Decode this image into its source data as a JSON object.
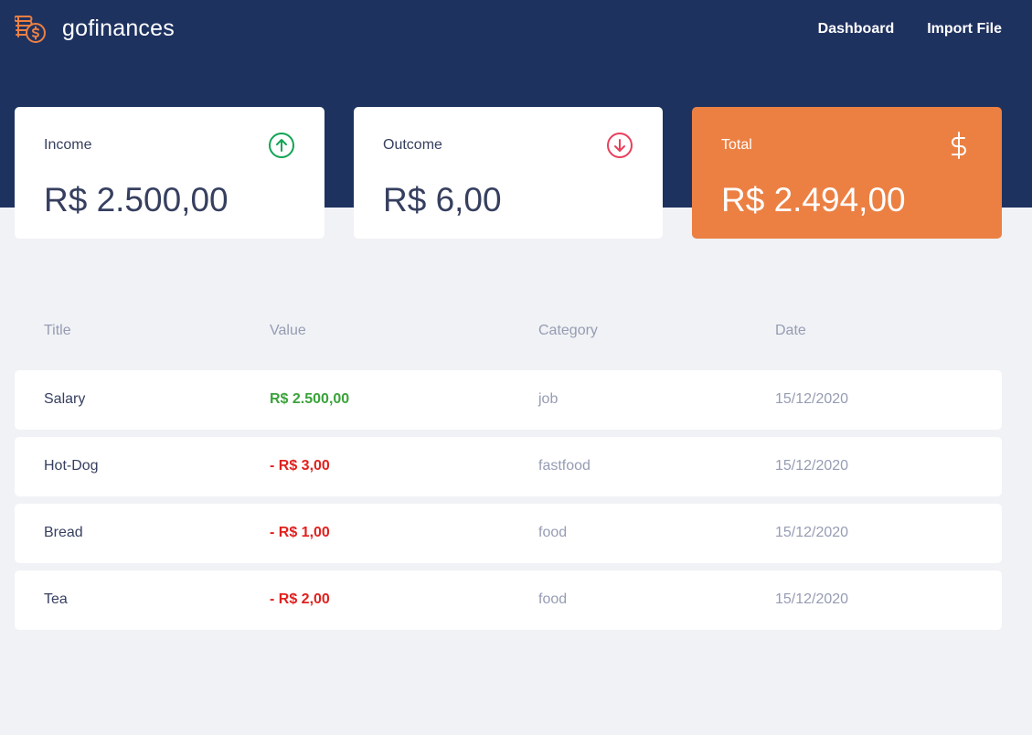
{
  "app": {
    "name": "gofinances"
  },
  "nav": {
    "dashboard": "Dashboard",
    "import": "Import File"
  },
  "cards": {
    "income": {
      "label": "Income",
      "value": "R$ 2.500,00",
      "icon": "arrow-up-circle-icon",
      "color": "#12a454"
    },
    "outcome": {
      "label": "Outcome",
      "value": "R$ 6,00",
      "icon": "arrow-down-circle-icon",
      "color": "#e83f5b"
    },
    "total": {
      "label": "Total",
      "value": "R$ 2.494,00",
      "icon": "dollar-sign-icon",
      "color": "#ec8043"
    }
  },
  "table": {
    "headers": {
      "title": "Title",
      "value": "Value",
      "category": "Category",
      "date": "Date"
    },
    "rows": [
      {
        "title": "Salary",
        "value": "R$ 2.500,00",
        "type": "income",
        "category": "job",
        "date": "15/12/2020"
      },
      {
        "title": "Hot-Dog",
        "value": "- R$ 3,00",
        "type": "outcome",
        "category": "fastfood",
        "date": "15/12/2020"
      },
      {
        "title": "Bread",
        "value": "- R$ 1,00",
        "type": "outcome",
        "category": "food",
        "date": "15/12/2020"
      },
      {
        "title": "Tea",
        "value": "- R$ 2,00",
        "type": "outcome",
        "category": "food",
        "date": "15/12/2020"
      }
    ]
  },
  "colors": {
    "header": "#1e3260",
    "accent": "#ec8043",
    "income": "#3aa33a",
    "outcome": "#e0211e",
    "background": "#f0f2f5"
  }
}
